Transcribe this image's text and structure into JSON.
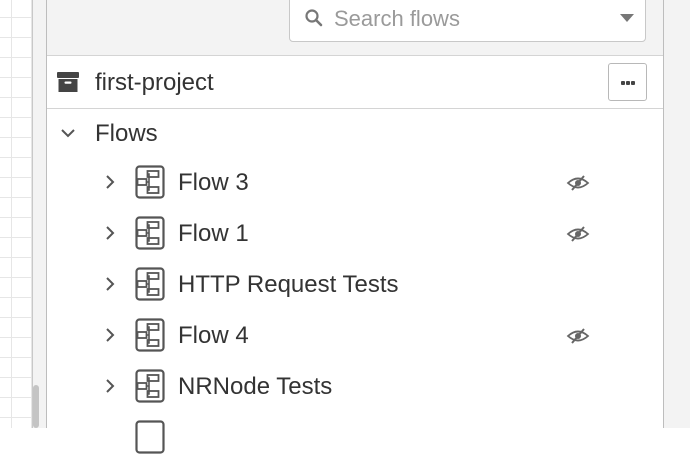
{
  "search": {
    "placeholder": "Search flows",
    "search_icon": "search-icon",
    "dropdown_icon": "caret-down-icon"
  },
  "project": {
    "name": "first-project",
    "icon": "archive-icon",
    "more_button_icon": "ellipsis-icon"
  },
  "flows_section": {
    "label": "Flows",
    "expanded": true,
    "icon": "chevron-down-icon"
  },
  "flows": [
    {
      "label": "Flow 3",
      "hidden": true
    },
    {
      "label": "Flow 1",
      "hidden": true
    },
    {
      "label": "HTTP Request Tests",
      "hidden": false
    },
    {
      "label": "Flow 4",
      "hidden": true
    },
    {
      "label": "NRNode Tests",
      "hidden": false
    },
    {
      "label": "",
      "hidden": false
    }
  ],
  "colors": {
    "text": "#333333",
    "icon": "#555555",
    "placeholder": "#9a9a9a",
    "panel_bg": "#ffffff",
    "toolbar_bg": "#f3f3f3",
    "border": "#d4d4d4"
  }
}
